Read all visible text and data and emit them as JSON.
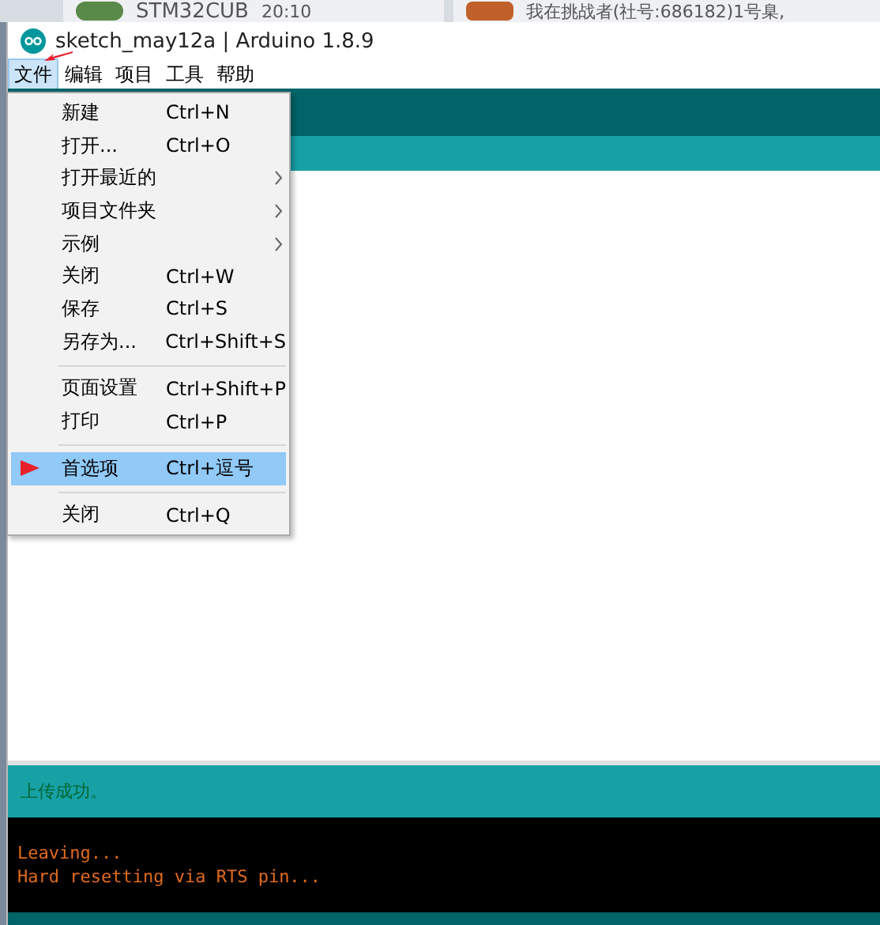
{
  "taskbar": {
    "items": [
      {
        "label": "STM32CUB",
        "time": "20:10"
      },
      {
        "label": "我在挑战者(社号:686182)1号臬,"
      }
    ]
  },
  "window": {
    "title": "sketch_may12a | Arduino 1.8.9"
  },
  "menubar": [
    {
      "label": "文件",
      "selected": true
    },
    {
      "label": "编辑",
      "selected": false
    },
    {
      "label": "项目",
      "selected": false
    },
    {
      "label": "工具",
      "selected": false
    },
    {
      "label": "帮助",
      "selected": false
    }
  ],
  "file_menu": [
    {
      "kind": "item",
      "label": "新建",
      "shortcut": "Ctrl+N",
      "submenu": false,
      "selected": false
    },
    {
      "kind": "item",
      "label": "打开...",
      "shortcut": "Ctrl+O",
      "submenu": false,
      "selected": false
    },
    {
      "kind": "item",
      "label": "打开最近的",
      "submenu": true,
      "selected": false
    },
    {
      "kind": "item",
      "label": "项目文件夹",
      "submenu": true,
      "selected": false
    },
    {
      "kind": "item",
      "label": "示例",
      "submenu": true,
      "selected": false
    },
    {
      "kind": "item",
      "label": "关闭",
      "shortcut": "Ctrl+W",
      "submenu": false,
      "selected": false
    },
    {
      "kind": "item",
      "label": "保存",
      "shortcut": "Ctrl+S",
      "submenu": false,
      "selected": false
    },
    {
      "kind": "item",
      "label": "另存为...",
      "shortcut": "Ctrl+Shift+S",
      "submenu": false,
      "selected": false
    },
    {
      "kind": "separator"
    },
    {
      "kind": "item",
      "label": "页面设置",
      "shortcut": "Ctrl+Shift+P",
      "submenu": false,
      "selected": false
    },
    {
      "kind": "item",
      "label": "打印",
      "shortcut": "Ctrl+P",
      "submenu": false,
      "selected": false
    },
    {
      "kind": "separator"
    },
    {
      "kind": "item",
      "label": "首选项",
      "shortcut": "Ctrl+逗号",
      "submenu": false,
      "selected": true
    },
    {
      "kind": "separator"
    },
    {
      "kind": "item",
      "label": "关闭",
      "shortcut": "Ctrl+Q",
      "submenu": false,
      "selected": false
    }
  ],
  "status": {
    "message": "上传成功。"
  },
  "console": {
    "lines": [
      "Leaving...",
      "Hard resetting via RTS pin..."
    ]
  }
}
